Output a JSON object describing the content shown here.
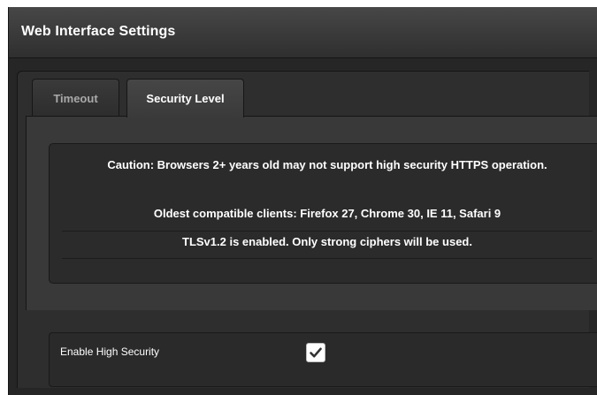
{
  "panel": {
    "title": "Web Interface Settings"
  },
  "tabs": [
    {
      "label": "Timeout",
      "active": false
    },
    {
      "label": "Security Level",
      "active": true
    }
  ],
  "info": {
    "caution": "Caution: Browsers 2+ years old may not support high security HTTPS operation.",
    "oldest_clients": "Oldest compatible clients: Firefox 27, Chrome 30, IE 11, Safari 9",
    "tls_status": "TLSv1.2 is enabled. Only strong ciphers will be used."
  },
  "settings": {
    "enable_high_security": {
      "label": "Enable High Security",
      "checked": true
    }
  },
  "colors": {
    "panel_background": "#262626",
    "header_gradient_top": "#474747",
    "tab_body": "#393939",
    "text": "#ffffff",
    "inactive_tab_text": "#a9a9a9"
  }
}
